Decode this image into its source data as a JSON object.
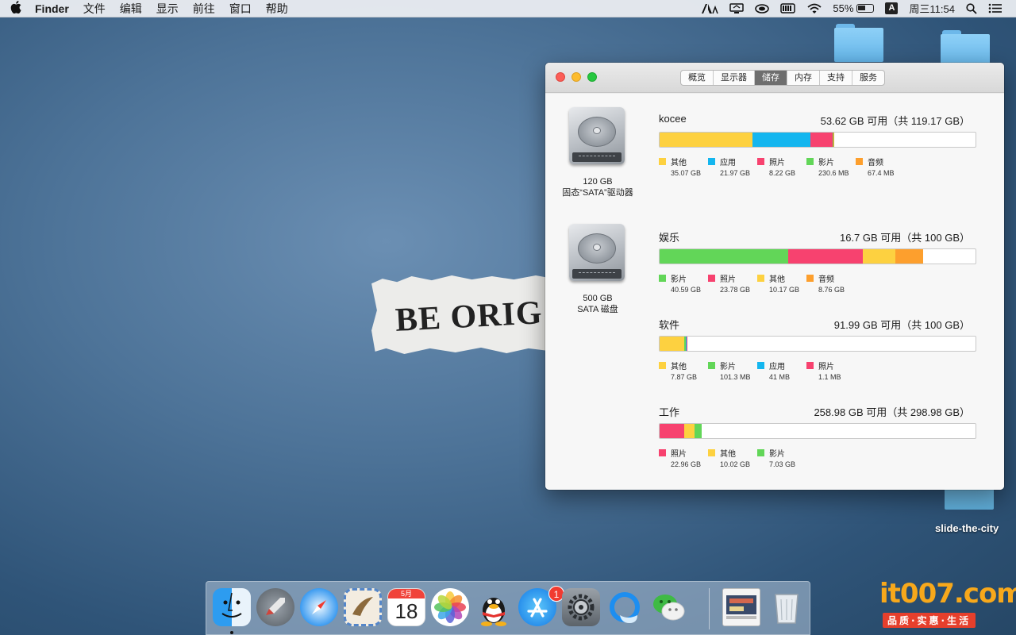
{
  "menubar": {
    "apple": "",
    "app": "Finder",
    "menus": [
      "文件",
      "编辑",
      "显示",
      "前往",
      "窗口",
      "帮助"
    ],
    "battery": "55%",
    "ime": "A",
    "clock": "周三11:54"
  },
  "desktop": {
    "item_label": "slide-the-city",
    "wallpaper_text": "BE ORIG"
  },
  "window": {
    "tabs": [
      "概览",
      "显示器",
      "储存",
      "内存",
      "支持",
      "服务"
    ],
    "active_tab": "储存",
    "disks": [
      {
        "size": "120 GB",
        "type": "固态“SATA”驱动器"
      },
      {
        "size": "500 GB",
        "type": "SATA 磁盘"
      }
    ],
    "volumes": [
      {
        "name": "kocee",
        "free": "53.62 GB 可用（共 119.17 GB）",
        "total_gb": 119.17,
        "items": [
          {
            "label": "其他",
            "size": "35.07 GB",
            "gb": 35.07,
            "color": "#fdd140"
          },
          {
            "label": "应用",
            "size": "21.97 GB",
            "gb": 21.97,
            "color": "#14b6ef"
          },
          {
            "label": "照片",
            "size": "8.22 GB",
            "gb": 8.22,
            "color": "#f7426f"
          },
          {
            "label": "影片",
            "size": "230.6 MB",
            "gb": 0.23,
            "color": "#62d658"
          },
          {
            "label": "音频",
            "size": "67.4 MB",
            "gb": 0.07,
            "color": "#fd9f2d"
          }
        ]
      },
      {
        "name": "娱乐",
        "free": "16.7 GB 可用（共 100 GB）",
        "total_gb": 100,
        "items": [
          {
            "label": "影片",
            "size": "40.59 GB",
            "gb": 40.59,
            "color": "#62d658"
          },
          {
            "label": "照片",
            "size": "23.78 GB",
            "gb": 23.78,
            "color": "#f7426f"
          },
          {
            "label": "其他",
            "size": "10.17 GB",
            "gb": 10.17,
            "color": "#fdd140"
          },
          {
            "label": "音频",
            "size": "8.76 GB",
            "gb": 8.76,
            "color": "#fd9f2d"
          }
        ]
      },
      {
        "name": "软件",
        "free": "91.99 GB 可用（共 100 GB）",
        "total_gb": 100,
        "items": [
          {
            "label": "其他",
            "size": "7.87 GB",
            "gb": 7.87,
            "color": "#fdd140"
          },
          {
            "label": "影片",
            "size": "101.3 MB",
            "gb": 0.1,
            "color": "#62d658"
          },
          {
            "label": "应用",
            "size": "41 MB",
            "gb": 0.04,
            "color": "#14b6ef"
          },
          {
            "label": "照片",
            "size": "1.1 MB",
            "gb": 0.001,
            "color": "#f7426f"
          }
        ]
      },
      {
        "name": "工作",
        "free": "258.98 GB 可用（共 298.98 GB）",
        "total_gb": 298.98,
        "items": [
          {
            "label": "照片",
            "size": "22.96 GB",
            "gb": 22.96,
            "color": "#f7426f"
          },
          {
            "label": "其他",
            "size": "10.02 GB",
            "gb": 10.02,
            "color": "#fdd140"
          },
          {
            "label": "影片",
            "size": "7.03 GB",
            "gb": 7.03,
            "color": "#62d658"
          }
        ]
      }
    ]
  },
  "dock": {
    "apps": [
      "finder-icon",
      "launchpad-icon",
      "safari-icon",
      "mail-icon",
      "calendar-icon",
      "photos-icon",
      "qq-icon",
      "app-store-icon",
      "system-preferences-icon",
      "browser-icon",
      "wechat-icon",
      "downloads-stack-icon",
      "trash-icon"
    ],
    "calendar_month": "5月",
    "calendar_day": "18",
    "app_store_badge": "1"
  },
  "watermark": {
    "logo": "it007.com",
    "tagline": "品质·实惠·生活"
  }
}
